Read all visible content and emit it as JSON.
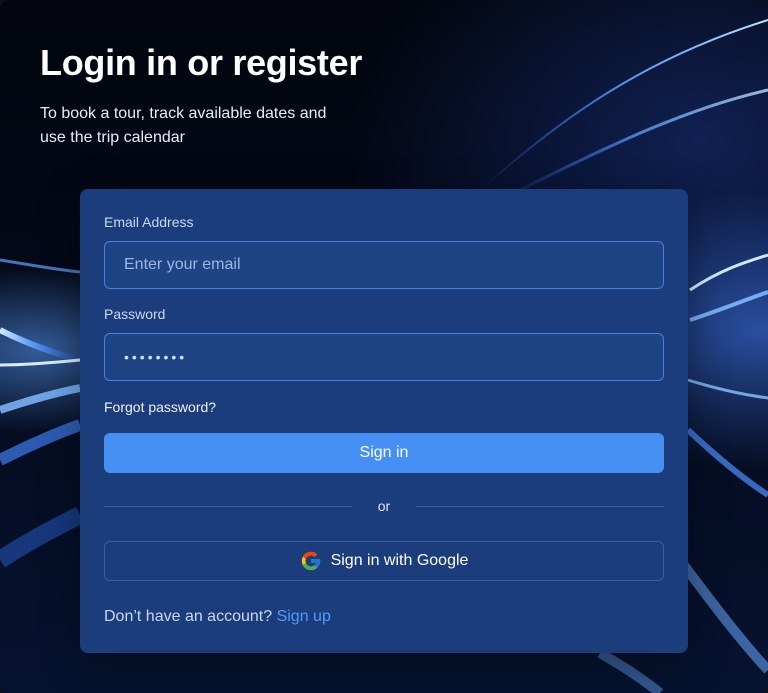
{
  "hero": {
    "title": "Login in or register",
    "subtitle": "To book a tour, track available dates and use the trip calendar"
  },
  "form": {
    "email": {
      "label": "Email Address",
      "placeholder": "Enter your email",
      "value": ""
    },
    "password": {
      "label": "Password",
      "masked_value": "••••••••"
    },
    "forgot_label": "Forgot password?",
    "sign_in_label": "Sign in",
    "divider_label": "or",
    "google_label": "Sign in with Google",
    "signup_prompt": "Don’t have an account?",
    "signup_link": "Sign up"
  },
  "colors": {
    "card_bg": "#1b3d7c",
    "primary_button": "#4590f2",
    "link": "#4f9bff"
  },
  "icons": {
    "google": "google-icon"
  }
}
